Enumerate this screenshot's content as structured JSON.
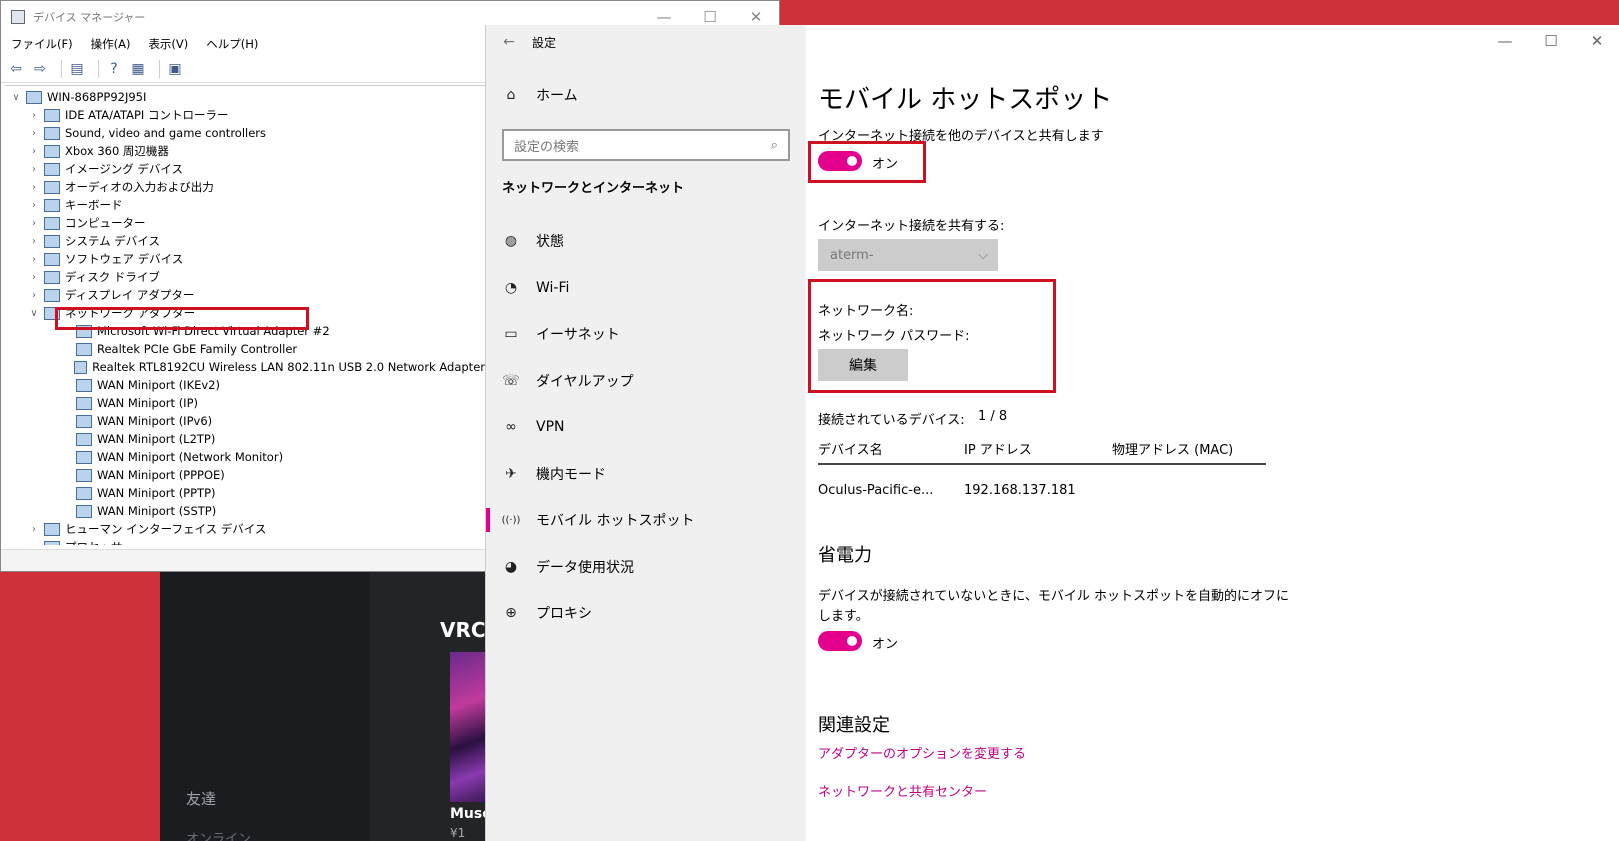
{
  "background_app": {
    "vrc": "VRC",
    "friends": "友達",
    "friends_sub": "オンライン",
    "muse": "Muse",
    "price": "¥1"
  },
  "device_manager": {
    "title": "デバイス マネージャー",
    "menu": [
      "ファイル(F)",
      "操作(A)",
      "表示(V)",
      "ヘルプ(H)"
    ],
    "tree": [
      {
        "level": 0,
        "chev": "∨",
        "label": "WIN-868PP92J95I"
      },
      {
        "level": 1,
        "chev": "›",
        "label": "IDE ATA/ATAPI コントローラー"
      },
      {
        "level": 1,
        "chev": "›",
        "label": "Sound, video and game controllers"
      },
      {
        "level": 1,
        "chev": "›",
        "label": "Xbox 360 周辺機器"
      },
      {
        "level": 1,
        "chev": "›",
        "label": "イメージング デバイス"
      },
      {
        "level": 1,
        "chev": "›",
        "label": "オーディオの入力および出力"
      },
      {
        "level": 1,
        "chev": "›",
        "label": "キーボード"
      },
      {
        "level": 1,
        "chev": "›",
        "label": "コンピューター"
      },
      {
        "level": 1,
        "chev": "›",
        "label": "システム デバイス"
      },
      {
        "level": 1,
        "chev": "›",
        "label": "ソフトウェア デバイス"
      },
      {
        "level": 1,
        "chev": "›",
        "label": "ディスク ドライブ"
      },
      {
        "level": 1,
        "chev": "›",
        "label": "ディスプレイ アダプター"
      },
      {
        "level": 1,
        "chev": "∨",
        "label": "ネットワーク アダプター"
      },
      {
        "level": 2,
        "chev": "",
        "label": "Microsoft Wi-Fi Direct Virtual Adapter #2"
      },
      {
        "level": 2,
        "chev": "",
        "label": "Realtek PCIe GbE Family Controller"
      },
      {
        "level": 2,
        "chev": "",
        "label": "Realtek RTL8192CU Wireless LAN 802.11n USB 2.0 Network Adapter"
      },
      {
        "level": 2,
        "chev": "",
        "label": "WAN Miniport (IKEv2)"
      },
      {
        "level": 2,
        "chev": "",
        "label": "WAN Miniport (IP)"
      },
      {
        "level": 2,
        "chev": "",
        "label": "WAN Miniport (IPv6)"
      },
      {
        "level": 2,
        "chev": "",
        "label": "WAN Miniport (L2TP)"
      },
      {
        "level": 2,
        "chev": "",
        "label": "WAN Miniport (Network Monitor)"
      },
      {
        "level": 2,
        "chev": "",
        "label": "WAN Miniport (PPPOE)"
      },
      {
        "level": 2,
        "chev": "",
        "label": "WAN Miniport (PPTP)"
      },
      {
        "level": 2,
        "chev": "",
        "label": "WAN Miniport (SSTP)"
      },
      {
        "level": 1,
        "chev": "›",
        "label": "ヒューマン インターフェイス デバイス"
      },
      {
        "level": 1,
        "chev": "›",
        "label": "プロセッサ"
      }
    ]
  },
  "settings": {
    "window_title": "設定",
    "home": "ホーム",
    "search_placeholder": "設定の検索",
    "section": "ネットワークとインターネット",
    "nav": [
      {
        "icon": "globe-icon",
        "glyph": "◍",
        "label": "状態"
      },
      {
        "icon": "wifi-icon",
        "glyph": "◔",
        "label": "Wi-Fi"
      },
      {
        "icon": "ethernet-icon",
        "glyph": "▭",
        "label": "イーサネット"
      },
      {
        "icon": "dialup-icon",
        "glyph": "☏",
        "label": "ダイヤルアップ"
      },
      {
        "icon": "vpn-icon",
        "glyph": "∞",
        "label": "VPN"
      },
      {
        "icon": "airplane-icon",
        "glyph": "✈",
        "label": "機内モード"
      },
      {
        "icon": "hotspot-icon",
        "glyph": "((·))",
        "label": "モバイル ホットスポット"
      },
      {
        "icon": "data-usage-icon",
        "glyph": "◕",
        "label": "データ使用状況"
      },
      {
        "icon": "proxy-icon",
        "glyph": "⊕",
        "label": "プロキシ"
      }
    ],
    "page_title": "モバイル ホットスポット",
    "share_desc": "インターネット接続を他のデバイスと共有します",
    "share_toggle_label": "オン",
    "share_from_label": "インターネット接続を共有する:",
    "share_from_value": "aterm-",
    "network_name_label": "ネットワーク名:",
    "network_password_label": "ネットワーク パスワード:",
    "edit_button": "編集",
    "connected_label": "接続されているデバイス:",
    "connected_value": "1 / 8",
    "table_headers": [
      "デバイス名",
      "IP アドレス",
      "物理アドレス (MAC)"
    ],
    "table_rows": [
      [
        "Oculus-Pacific-e...",
        "192.168.137.181",
        ""
      ]
    ],
    "power_title": "省電力",
    "power_desc_1": "デバイスが接続されていないときに、モバイル ホットスポットを自動的にオフに",
    "power_desc_2": "します。",
    "power_toggle_label": "オン",
    "related_title": "関連設定",
    "link_adapter": "アダプターのオプションを変更する",
    "link_sharing_center": "ネットワークと共有センター"
  },
  "colors": {
    "accent": "#e3008c",
    "highlight": "#d01020",
    "background": "#d0303a"
  }
}
